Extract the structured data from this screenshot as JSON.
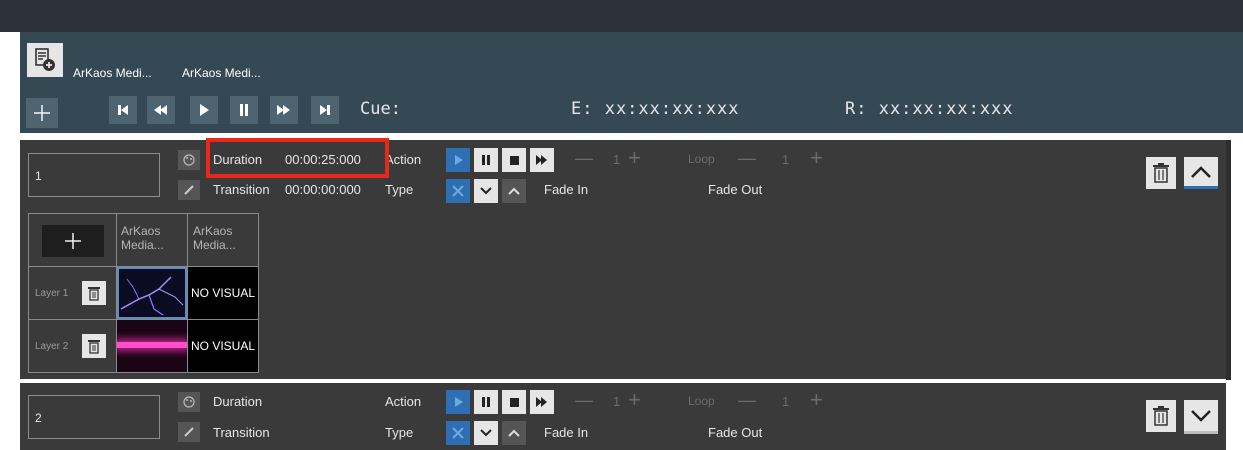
{
  "header": {
    "sources": [
      "ArKaos Medi...",
      "ArKaos Medi..."
    ],
    "cue_label": "Cue:",
    "elapsed_label": "E: xx:xx:xx:xxx",
    "remaining_label": "R: xx:xx:xx:xxx"
  },
  "cues": [
    {
      "number": "1",
      "duration_label": "Duration",
      "duration_value": "00:00:25:000",
      "transition_label": "Transition",
      "transition_value": "00:00:00:000",
      "action_label": "Action",
      "type_label": "Type",
      "count": "1",
      "loop_label": "Loop",
      "loop_count": "1",
      "fade_in": "Fade In",
      "fade_out": "Fade Out"
    },
    {
      "number": "2",
      "duration_label": "Duration",
      "duration_value": "",
      "transition_label": "Transition",
      "transition_value": "",
      "action_label": "Action",
      "type_label": "Type",
      "count": "1",
      "loop_label": "Loop",
      "loop_count": "1",
      "fade_in": "Fade In",
      "fade_out": "Fade Out"
    }
  ],
  "grid": {
    "columns": [
      "ArKaos\nMedia...",
      "ArKaos\nMedia..."
    ],
    "layers": [
      {
        "name": "Layer 1",
        "col2": "NO VISUAL"
      },
      {
        "name": "Layer 2",
        "col2": "NO VISUAL"
      }
    ]
  },
  "colors": {
    "accent": "#2d6fb2",
    "highlight": "#e8281c",
    "panel": "#354954",
    "cue_bg": "#3a3a3a"
  }
}
